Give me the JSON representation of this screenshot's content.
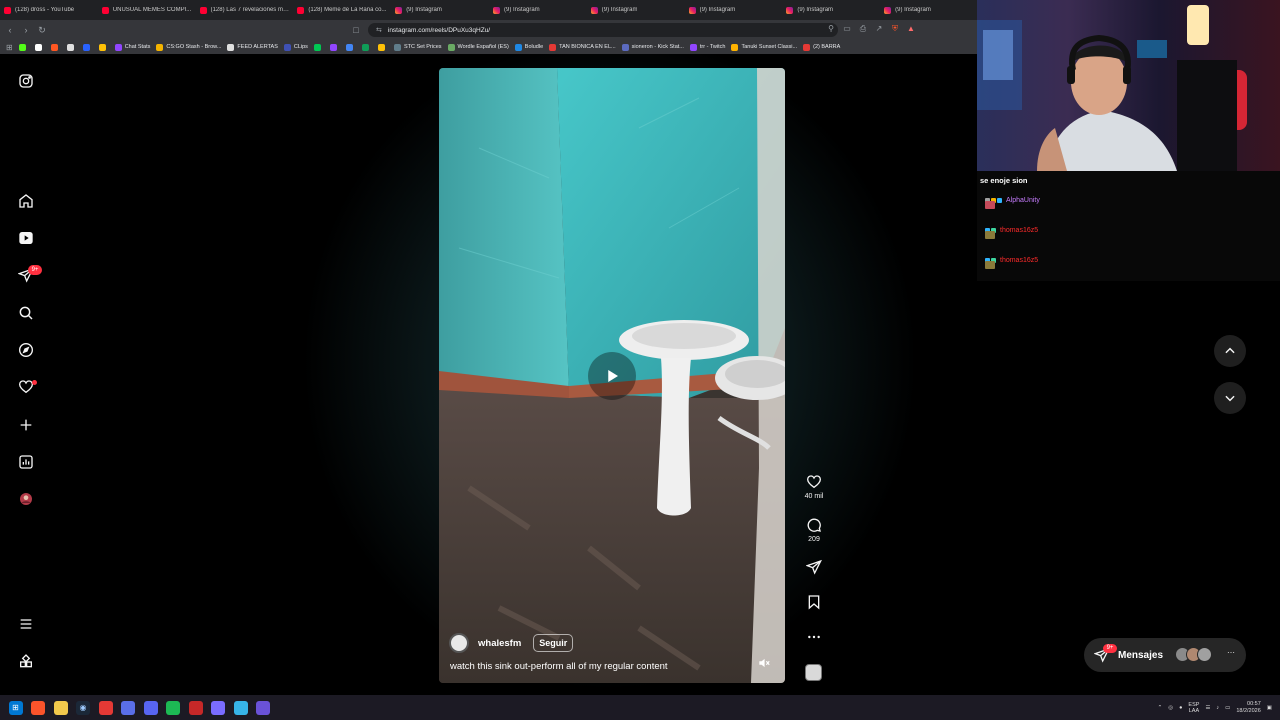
{
  "browser": {
    "tabs": [
      {
        "title": "(128) dross - YouTube",
        "icon": "youtube-icon"
      },
      {
        "title": "UNUSUAL MEMES COMPI...",
        "icon": "youtube-icon"
      },
      {
        "title": "(128) Las 7 revelaciones má...",
        "icon": "youtube-icon"
      },
      {
        "title": "(128) Meme de La Rana co...",
        "icon": "youtube-icon"
      },
      {
        "title": "(9) Instagram",
        "icon": "instagram-icon"
      },
      {
        "title": "(9) Instagram",
        "icon": "instagram-icon"
      },
      {
        "title": "(9) Instagram",
        "icon": "instagram-icon"
      },
      {
        "title": "(9) Instagram",
        "icon": "instagram-icon"
      },
      {
        "title": "(9) Instagram",
        "icon": "instagram-icon"
      },
      {
        "title": "(9) Instagram",
        "icon": "instagram-icon"
      }
    ],
    "url": "instagram.com/reels/DPuXu3qHZu/",
    "bookmarks": [
      {
        "label": "",
        "color": "#53fc18"
      },
      {
        "label": "",
        "color": "#ffffff"
      },
      {
        "label": "",
        "color": "#ff5722"
      },
      {
        "label": "",
        "color": "#e0e0e0"
      },
      {
        "label": "",
        "color": "#2962ff"
      },
      {
        "label": "",
        "color": "#ffc107"
      },
      {
        "label": "Chat Stats",
        "color": "#9146ff"
      },
      {
        "label": "CS:GO Stash - Brow...",
        "color": "#f4b400"
      },
      {
        "label": "FEED ALERTAS",
        "color": "#e0e0e0"
      },
      {
        "label": "CLips",
        "color": "#3f51b5"
      },
      {
        "label": "",
        "color": "#00c853"
      },
      {
        "label": "",
        "color": "#9146ff"
      },
      {
        "label": "",
        "color": "#4285f4"
      },
      {
        "label": "",
        "color": "#0f9d58"
      },
      {
        "label": "",
        "color": "#ffc107"
      },
      {
        "label": "STC Set Prices",
        "color": "#607d8b"
      },
      {
        "label": "Wordle Español (ES)",
        "color": "#6aaa64"
      },
      {
        "label": "Boludle",
        "color": "#1e88e5"
      },
      {
        "label": "TAN BIONICA EN EL...",
        "color": "#e53935"
      },
      {
        "label": "sioneron - Kick Stat...",
        "color": "#5c6bc0"
      },
      {
        "label": "trr - Twitch",
        "color": "#9146ff"
      },
      {
        "label": "Tanuki Sunset Classi...",
        "color": "#ffb300"
      },
      {
        "label": "(2) BARRA",
        "color": "#e53935"
      }
    ]
  },
  "sidebar": {
    "items": [
      {
        "name": "instagram-logo-icon"
      },
      {
        "name": "home-icon"
      },
      {
        "name": "reels-icon"
      },
      {
        "name": "direct-messages-icon"
      },
      {
        "name": "search-icon"
      },
      {
        "name": "explore-icon"
      },
      {
        "name": "notifications-heart-icon"
      },
      {
        "name": "create-plus-icon"
      },
      {
        "name": "dashboard-icon"
      },
      {
        "name": "profile-avatar"
      },
      {
        "name": "more-menu-icon"
      },
      {
        "name": "also-from-meta-icon"
      }
    ],
    "messages_badge": "9+"
  },
  "reel": {
    "username": "whalesfm",
    "follow_label": "Seguir",
    "caption": "watch this sink out-perform all of my regular content",
    "likes": "40 mil",
    "comments": "209"
  },
  "stream": {
    "chat_title": "se enoje sion",
    "chat_users": [
      {
        "name": "AlphaUnity",
        "color": "#c77dff"
      },
      {
        "name": "thomas16z5",
        "color": "#ff2b2b"
      },
      {
        "name": "thomas16z5",
        "color": "#ff2b2b"
      }
    ]
  },
  "messages": {
    "label": "Mensajes",
    "badge": "9+"
  },
  "taskbar": {
    "lang_top": "ESP",
    "lang_bottom": "LAA",
    "time": "00:57",
    "date": "18/2/2026"
  },
  "colors": {
    "instagram_red": "#ff3040",
    "tab_bg": "#202124",
    "toolbar_bg": "#35363a"
  }
}
